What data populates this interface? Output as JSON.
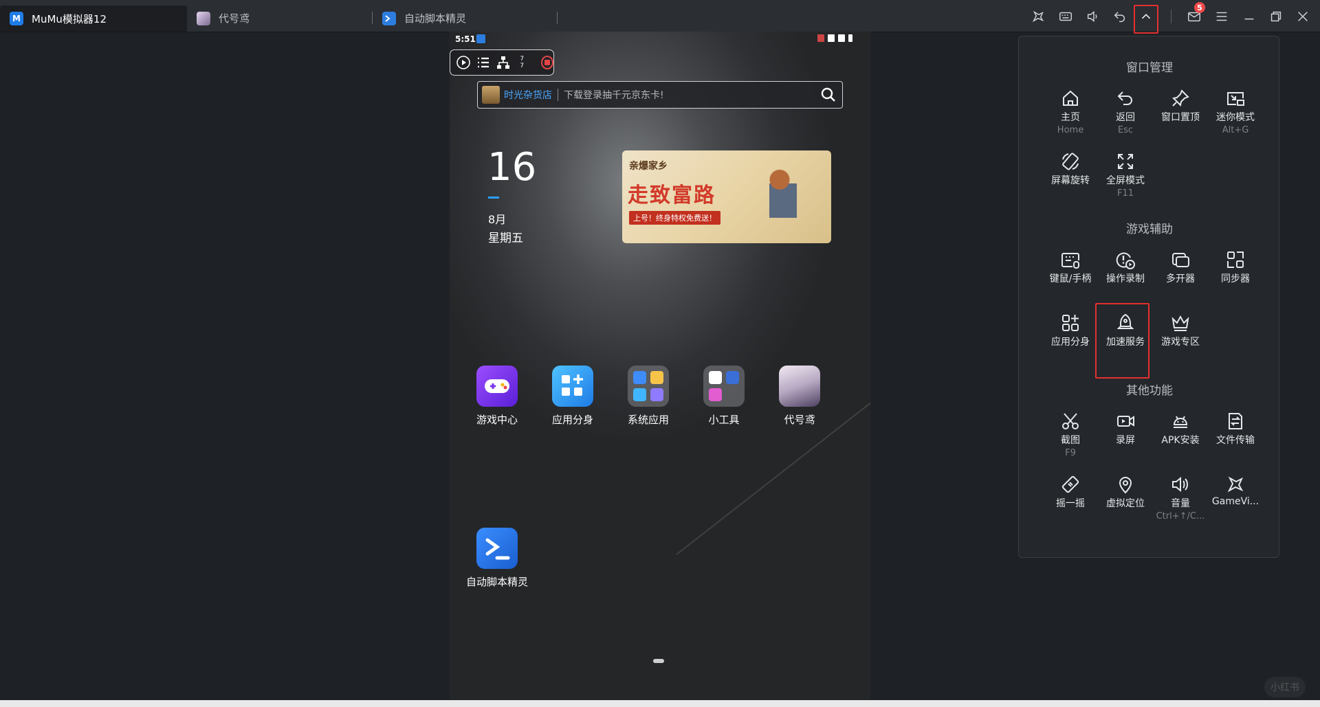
{
  "titlebar": {
    "tabs": [
      {
        "label": "MuMu模拟器12",
        "icon": "mumu-logo-icon",
        "color": "#1f7de8"
      },
      {
        "label": "代号鸢",
        "icon": "game-avatar-icon",
        "color": "#b8a6c8"
      },
      {
        "label": "自动脚本精灵",
        "icon": "script-terminal-icon",
        "color": "#2d7de0"
      }
    ],
    "toolbar": [
      "gamevi-icon",
      "keyboard-icon",
      "volume-icon",
      "back-icon",
      "collapse-chevron-icon",
      "mail-icon",
      "menu-icon",
      "minimize-icon",
      "restore-icon",
      "close-icon"
    ],
    "mail_badge": "5"
  },
  "phone": {
    "status": {
      "time": "5:51"
    },
    "macro_bar": {
      "count_top": "7",
      "count_bottom": "7"
    },
    "search": {
      "store": "时光杂货店",
      "placeholder": "下载登录抽千元京东卡!"
    },
    "clock": {
      "day": "16",
      "month": "8月",
      "weekday": "星期五"
    },
    "banner": {
      "subtitle": "亲爆家乡",
      "title": "走致富路",
      "footer": "上号！终身特权免费送！"
    },
    "apps": [
      {
        "label": "游戏中心",
        "icon": "gamepad-icon"
      },
      {
        "label": "应用分身",
        "icon": "app-clone-icon"
      },
      {
        "label": "系统应用",
        "icon": "system-apps-folder-icon"
      },
      {
        "label": "小工具",
        "icon": "tools-folder-icon"
      },
      {
        "label": "代号鸢",
        "icon": "game-avatar-icon"
      },
      {
        "label": "自动脚本精灵",
        "icon": "script-terminal-icon"
      }
    ]
  },
  "panel": {
    "sections": [
      {
        "title": "窗口管理",
        "items": [
          {
            "label": "主页",
            "key": "Home",
            "icon": "home-icon"
          },
          {
            "label": "返回",
            "key": "Esc",
            "icon": "back-icon"
          },
          {
            "label": "窗口置顶",
            "key": "",
            "icon": "pin-icon"
          },
          {
            "label": "迷你模式",
            "key": "Alt+G",
            "icon": "mini-mode-icon"
          },
          {
            "label": "屏幕旋转",
            "key": "",
            "icon": "rotate-icon"
          },
          {
            "label": "全屏模式",
            "key": "F11",
            "icon": "fullscreen-icon"
          }
        ]
      },
      {
        "title": "游戏辅助",
        "items": [
          {
            "label": "键鼠/手柄",
            "key": "",
            "icon": "keyboard-mouse-icon"
          },
          {
            "label": "操作录制",
            "key": "",
            "icon": "record-macro-icon"
          },
          {
            "label": "多开器",
            "key": "",
            "icon": "multi-instance-icon"
          },
          {
            "label": "同步器",
            "key": "",
            "icon": "sync-icon"
          },
          {
            "label": "应用分身",
            "key": "",
            "icon": "app-clone-icon"
          },
          {
            "label": "加速服务",
            "key": "",
            "icon": "rocket-icon"
          },
          {
            "label": "游戏专区",
            "key": "",
            "icon": "crown-icon"
          }
        ]
      },
      {
        "title": "其他功能",
        "items": [
          {
            "label": "截图",
            "key": "F9",
            "icon": "scissors-icon"
          },
          {
            "label": "录屏",
            "key": "",
            "icon": "video-record-icon"
          },
          {
            "label": "APK安装",
            "key": "",
            "icon": "android-icon"
          },
          {
            "label": "文件传输",
            "key": "",
            "icon": "file-transfer-icon"
          },
          {
            "label": "摇一摇",
            "key": "",
            "icon": "shake-icon"
          },
          {
            "label": "虚拟定位",
            "key": "",
            "icon": "location-icon"
          },
          {
            "label": "音量",
            "key": "Ctrl+↑/C...",
            "icon": "volume-icon"
          },
          {
            "label": "GameVi...",
            "key": "",
            "icon": "gamevi-icon"
          }
        ]
      }
    ]
  },
  "watermark": "小红书"
}
